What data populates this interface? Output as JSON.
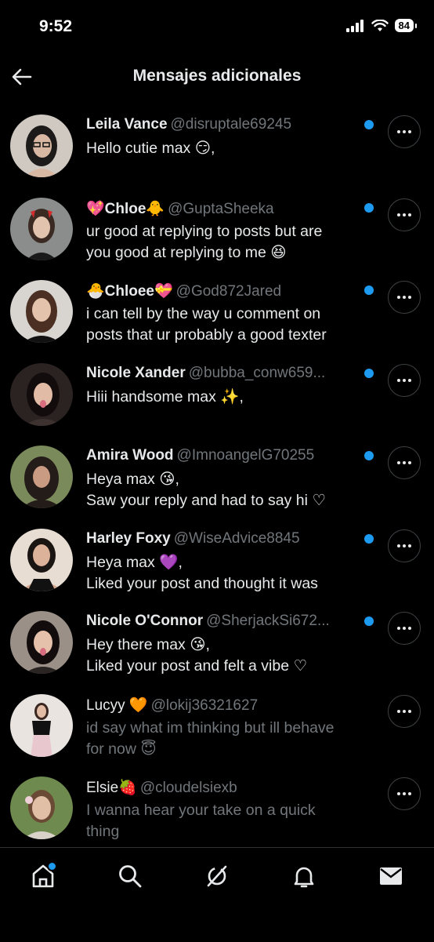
{
  "status": {
    "time": "9:52",
    "battery": "84"
  },
  "header": {
    "title": "Mensajes adicionales",
    "back_icon": "arrow-left-icon"
  },
  "colors": {
    "unread_dot": "#1d9bf0",
    "background": "#000000",
    "secondary_text": "#71767b"
  },
  "messages": [
    {
      "name": "Leila Vance",
      "handle": "@disruptale69245",
      "lines": [
        "Hello cutie max 😏,"
      ],
      "unread": true
    },
    {
      "name": "💖Chloe🐥",
      "handle": "@GuptaSheeka",
      "lines": [
        "ur good at replying to posts but are",
        "you good at replying to me 😆"
      ],
      "unread": true
    },
    {
      "name": "🐣Chloee💝",
      "handle": "@God872Jared",
      "lines": [
        "i can tell by the way u comment on",
        "posts that ur probably a good texter"
      ],
      "unread": true
    },
    {
      "name": "Nicole Xander",
      "handle": "@bubba_conw659...",
      "lines": [
        "Hiii handsome max ✨,"
      ],
      "unread": true
    },
    {
      "name": "Amira Wood",
      "handle": "@ImnoangelG70255",
      "lines": [
        "Heya max 😘,",
        "Saw your reply and had to say hi ♡"
      ],
      "unread": true
    },
    {
      "name": "Harley Foxy",
      "handle": "@WiseAdvice8845",
      "lines": [
        "Heya max 💜,",
        "Liked your post and thought it was"
      ],
      "unread": true
    },
    {
      "name": "Nicole O'Connor",
      "handle": "@SherjackSi672...",
      "lines": [
        "Hey there max 😘,",
        "Liked your post and felt a vibe ♡"
      ],
      "unread": true
    },
    {
      "name": "Lucyy 🧡",
      "handle": "@lokij36321627",
      "lines": [
        "id say what im thinking but ill behave",
        "for now 😇"
      ],
      "unread": false
    },
    {
      "name": "Elsie🍓",
      "handle": "@cloudelsiexb",
      "lines": [
        "I wanna hear your take on a quick",
        "thing"
      ],
      "unread": false
    }
  ],
  "tabs": [
    {
      "icon": "home-icon",
      "badge": true
    },
    {
      "icon": "search-icon",
      "badge": false
    },
    {
      "icon": "grok-icon",
      "badge": false
    },
    {
      "icon": "bell-icon",
      "badge": false
    },
    {
      "icon": "mail-icon",
      "badge": false
    }
  ]
}
